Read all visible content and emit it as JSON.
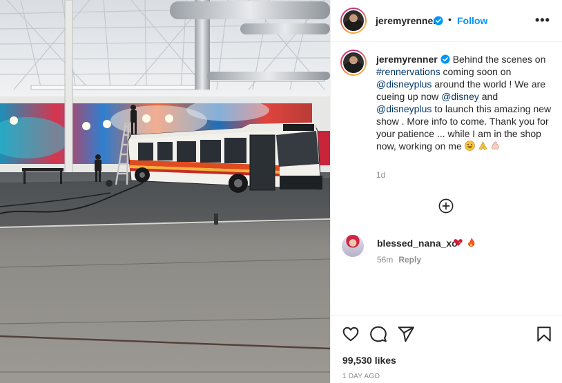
{
  "post": {
    "author": "jeremyrenner",
    "follow_label": "Follow",
    "dot": "•",
    "more_label": "•••",
    "caption": {
      "author": "jeremyrenner",
      "t1": "Behind the scenes on ",
      "tag": "#rennervations",
      "t2": " coming soon on ",
      "mention1": "@disneyplus",
      "t3": " around the world ! We are cueing up now ",
      "mention2": "@disney",
      "t4": " and ",
      "mention3": "@disneyplus",
      "t5": " to launch this amazing new show . More info to come. Thank you for your patience ... while I am in the shop now, working on me ",
      "time": "1d"
    },
    "comment": {
      "user": "blessed_nana_xo",
      "time": "56m",
      "reply_label": "Reply"
    },
    "likes": "99,530 likes",
    "posted": "1 DAY AGO"
  },
  "icons": {
    "verified": "verified-badge-icon",
    "load_more": "plus-circle-icon",
    "like": "heart-icon",
    "comment": "comment-bubble-icon",
    "share": "paper-plane-icon",
    "save": "bookmark-icon"
  },
  "colors": {
    "accent": "#0095f6",
    "link": "#00376b",
    "muted": "#8e8e8e",
    "text": "#262626"
  }
}
